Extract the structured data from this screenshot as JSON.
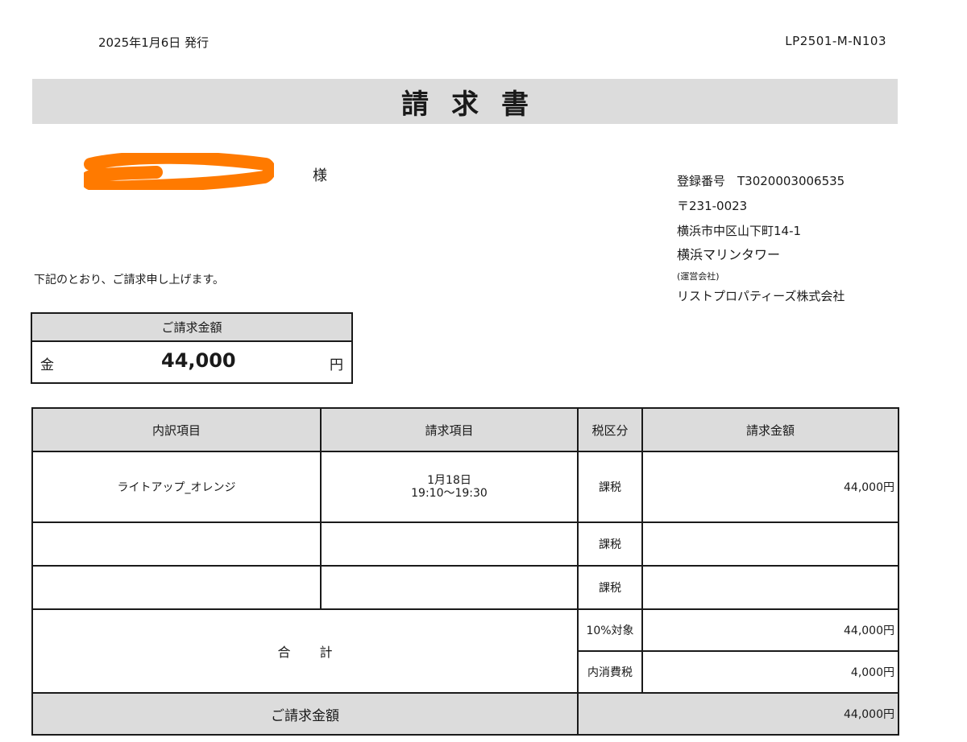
{
  "header": {
    "issue_date": "2025年1月6日 発行",
    "doc_number": "LP2501-M-N103",
    "title": "請求書"
  },
  "recipient": {
    "honorific": "様",
    "redaction_color": "#ff7a00"
  },
  "issuer": {
    "registration": "登録番号　T3020003006535",
    "postal": "〒231-0023",
    "address": "横浜市中区山下町14-1",
    "building": "横浜マリンタワー",
    "operator_label": "(運営会社)",
    "company": "リストプロパティーズ株式会社"
  },
  "intro": "下記のとおり、ご請求申し上げます。",
  "amount_box": {
    "header": "ご請求金額",
    "prefix": "金",
    "amount": "44,000",
    "unit": "円"
  },
  "table": {
    "headers": [
      "内訳項目",
      "請求項目",
      "税区分",
      "請求金額"
    ],
    "rows": [
      {
        "item": "ライトアップ_オレンジ",
        "detail_line1": "1月18日",
        "detail_line2": "19:10〜19:30",
        "tax": "課税",
        "amount": "44,000円"
      },
      {
        "item": "",
        "detail_line1": "",
        "detail_line2": "",
        "tax": "課税",
        "amount": ""
      },
      {
        "item": "",
        "detail_line1": "",
        "detail_line2": "",
        "tax": "課税",
        "amount": ""
      }
    ],
    "total_label": "合計",
    "subtotal_rows": [
      {
        "label": "10%対象",
        "amount": "44,000円"
      },
      {
        "label": "内消費税",
        "amount": "4,000円"
      }
    ],
    "final_label": "ご請求金額",
    "final_amount": "44,000円"
  },
  "colors": {
    "header_grey": "#dcdcdc",
    "border": "#1a1a1a"
  }
}
